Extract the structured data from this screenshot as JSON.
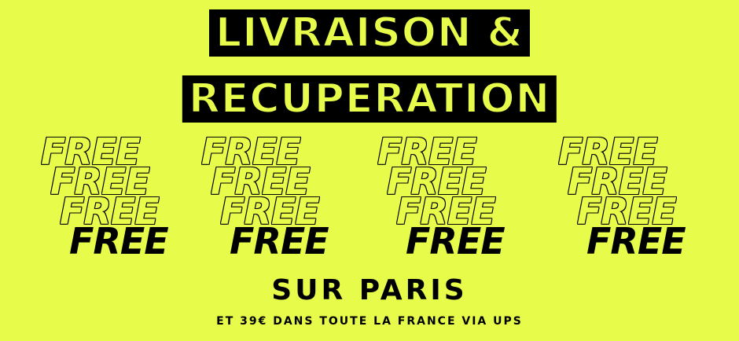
{
  "banner": {
    "title_line1": "LIVRAISON &",
    "title_line2": "RECUPERATION",
    "free_word": "FREE",
    "subtitle": "SUR PARIS",
    "caption": "ET 39€ DANS TOUTE LA FRANCE VIA UPS",
    "background_color": "#e6fb4a",
    "text_color": "#000000"
  }
}
